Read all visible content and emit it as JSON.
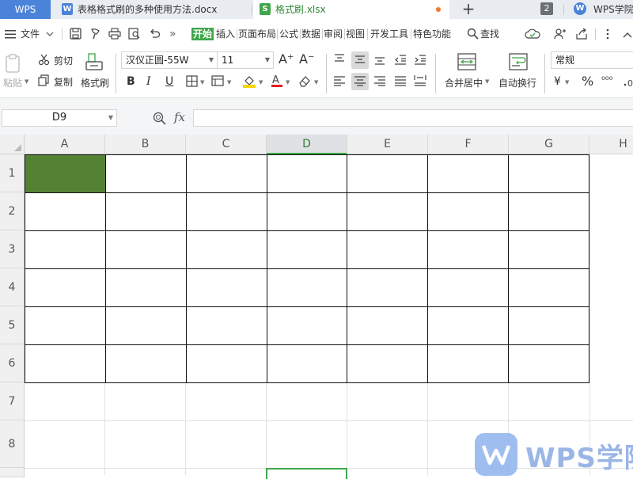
{
  "tabbar": {
    "wps_label": "WPS",
    "doc_tab_label": "表格格式刷的多种使用方法.docx",
    "doc_tab_icon": "W",
    "xlsx_tab_label": "格式刷.xlsx",
    "xlsx_tab_icon": "S",
    "plus_label": "+",
    "badge_count": "2",
    "academy_label": "WPS学院",
    "colors": {
      "wps_tab": "#4b83d9",
      "doc_icon": "#4b83d9",
      "xlsx_icon": "#3fa64a",
      "unsaved_dot": "#f07a2c"
    }
  },
  "menubar": {
    "file_label": "文件",
    "more_label": "»",
    "tabs": [
      {
        "label": "开始",
        "active": true
      },
      {
        "label": "插入"
      },
      {
        "label": "页面布局"
      },
      {
        "label": "公式"
      },
      {
        "label": "数据"
      },
      {
        "label": "审阅"
      },
      {
        "label": "视图"
      },
      {
        "label": "开发工具"
      },
      {
        "label": "特色功能"
      }
    ],
    "search_label": "查找"
  },
  "ribbon": {
    "paste_label": "粘贴",
    "cut_label": "剪切",
    "copy_label": "复制",
    "format_painter_label": "格式刷",
    "font_name": "汉仪正圆-55W",
    "font_size": "11",
    "bold": "B",
    "italic": "I",
    "underline": "U",
    "grow_font": "A⁺",
    "shrink_font": "A⁻",
    "merge_label": "合并居中",
    "wrap_label": "自动换行",
    "number_format": "常规",
    "currency": "¥",
    "percent": "%",
    "thousands": "⁰⁰⁰",
    "font_color": "#e02020",
    "fill_color": "#f5d600"
  },
  "formulabar": {
    "namebox_value": "D9",
    "fx_label": "fx",
    "formula_value": ""
  },
  "grid": {
    "columns": [
      "A",
      "B",
      "C",
      "D",
      "E",
      "F",
      "G",
      "H"
    ],
    "selected_column": "D",
    "rows": [
      "1",
      "2",
      "3",
      "4",
      "5",
      "6",
      "7",
      "8"
    ],
    "filled_cell": "A1",
    "fill_color": "#548235",
    "selection_color": "#3fa64a"
  },
  "watermark": {
    "text": "WPS学院"
  }
}
